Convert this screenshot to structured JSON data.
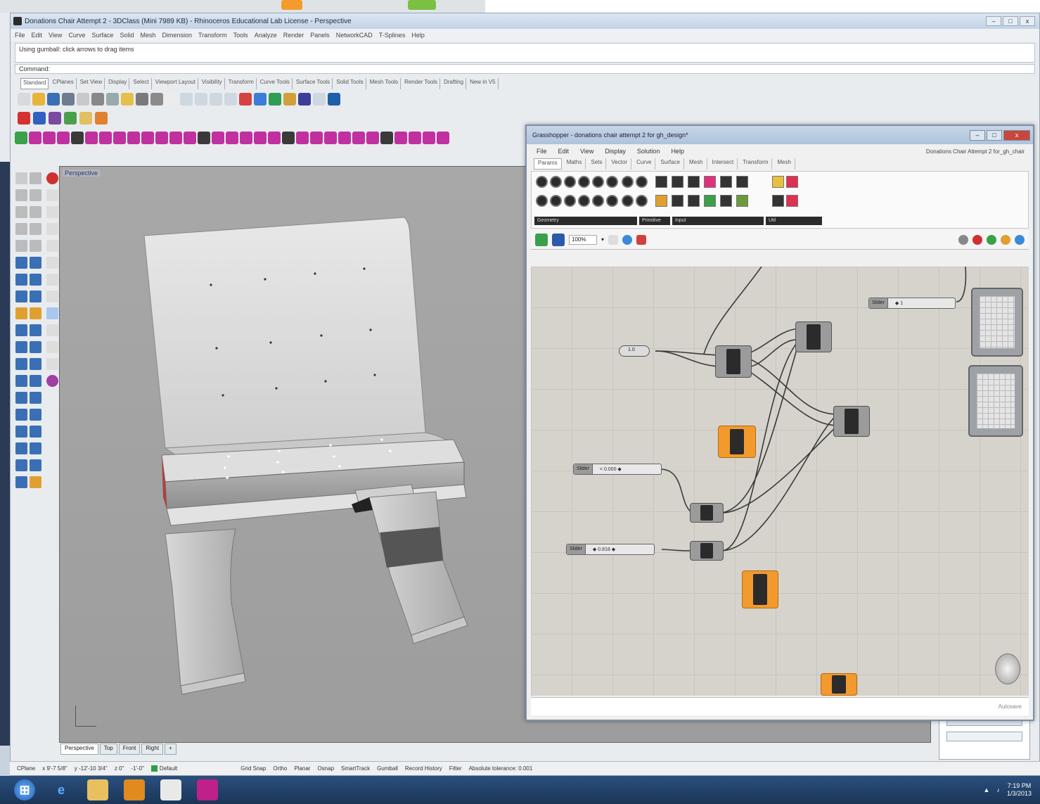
{
  "rhino": {
    "title": "Donations Chair Attempt 2 - 3DClass (Mini 7989 KB) - Rhinoceros Educational Lab License - Perspective",
    "menu": [
      "File",
      "Edit",
      "View",
      "Curve",
      "Surface",
      "Solid",
      "Mesh",
      "Dimension",
      "Transform",
      "Tools",
      "Analyze",
      "Render",
      "Panels",
      "NetworkCAD",
      "T-Splines",
      "Help"
    ],
    "command_history": "Using gumball: click arrows to drag items",
    "command_prompt": "Command:",
    "toolbar_tabs": [
      "Standard",
      "CPlanes",
      "Set View",
      "Display",
      "Select",
      "Viewport Layout",
      "Visibility",
      "Transform",
      "Curve Tools",
      "Surface Tools",
      "Solid Tools",
      "Mesh Tools",
      "Render Tools",
      "Drafting",
      "New in V5"
    ],
    "viewport_label": "Perspective",
    "view_tabs": [
      "Perspective",
      "Top",
      "Front",
      "Right",
      "+"
    ],
    "status": {
      "cplane": "CPlane",
      "x": "x 9'-7 5/8\"",
      "y": "y -12'-10 3/4\"",
      "z": "z 0\"",
      "layer_dist": "-1'-0\"",
      "osnap": "Default",
      "items": [
        "Grid Snap",
        "Ortho",
        "Planar",
        "Osnap",
        "SmartTrack",
        "Gumball",
        "Record History",
        "Filter",
        "Absolute tolerance: 0.001"
      ]
    }
  },
  "grasshopper": {
    "title": "Grasshopper - donations chair attempt 2 for gh_design*",
    "menu": [
      "File",
      "Edit",
      "View",
      "Display",
      "Solution",
      "Help"
    ],
    "document": "Donations Chair Attempt 2 for_gh_chair",
    "tabs": [
      "Params",
      "Maths",
      "Sets",
      "Vector",
      "Curve",
      "Surface",
      "Mesh",
      "Intersect",
      "Transform",
      "Mesh"
    ],
    "ribbon_groups": [
      "Geometry",
      "Primitive",
      "Input",
      "Util"
    ],
    "zoom": "100%",
    "sliders": [
      {
        "name": "Slider",
        "value": "< 0.000 ◆"
      },
      {
        "name": "Slider",
        "value": "◆ 0.818 ◆"
      },
      {
        "name": "Slider",
        "value": "◆ 1"
      }
    ],
    "panel_label": "1.0",
    "status_text": "Autosave"
  },
  "taskbar": {
    "time": "7:19 PM",
    "date": "1/3/2013"
  }
}
